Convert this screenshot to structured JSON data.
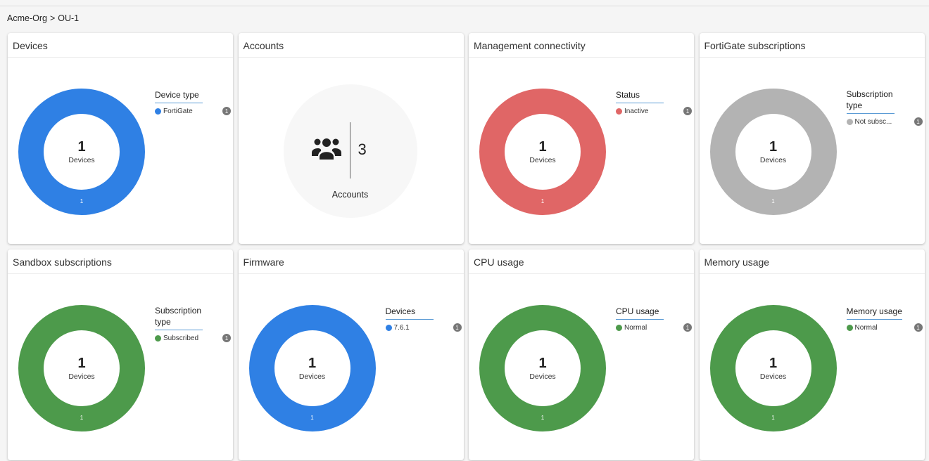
{
  "breadcrumb": {
    "org": "Acme-Org",
    "separator": ">",
    "ou": "OU-1"
  },
  "colors": {
    "blue": "#2f80e4",
    "red": "#e06666",
    "gray": "#b3b3b3",
    "green": "#4d9a4b"
  },
  "cards": {
    "devices": {
      "title": "Devices",
      "donut": {
        "count": "1",
        "label": "Devices",
        "segment_value": "1",
        "color": "#2f80e4"
      },
      "legend": {
        "title": "Device type",
        "items": [
          {
            "label": "FortiGate",
            "count": "1",
            "color": "#2f80e4"
          }
        ]
      }
    },
    "accounts": {
      "title": "Accounts",
      "icon": "users-icon",
      "count": "3",
      "label": "Accounts"
    },
    "management": {
      "title": "Management connectivity",
      "donut": {
        "count": "1",
        "label": "Devices",
        "segment_value": "1",
        "color": "#e06666"
      },
      "legend": {
        "title": "Status",
        "items": [
          {
            "label": "Inactive",
            "count": "1",
            "color": "#e06666"
          }
        ]
      }
    },
    "fortigate_subs": {
      "title": "FortiGate subscriptions",
      "donut": {
        "count": "1",
        "label": "Devices",
        "segment_value": "1",
        "color": "#b3b3b3"
      },
      "legend": {
        "title_line1": "Subscription",
        "title_line2": "type",
        "items": [
          {
            "label": "Not subsc...",
            "count": "1",
            "color": "#b3b3b3"
          }
        ]
      }
    },
    "sandbox_subs": {
      "title": "Sandbox subscriptions",
      "donut": {
        "count": "1",
        "label": "Devices",
        "segment_value": "1",
        "color": "#4d9a4b"
      },
      "legend": {
        "title_line1": "Subscription",
        "title_line2": "type",
        "items": [
          {
            "label": "Subscribed",
            "count": "1",
            "color": "#4d9a4b"
          }
        ]
      }
    },
    "firmware": {
      "title": "Firmware",
      "donut": {
        "count": "1",
        "label": "Devices",
        "segment_value": "1",
        "color": "#2f80e4"
      },
      "legend": {
        "title": "Devices",
        "items": [
          {
            "label": "7.6.1",
            "count": "1",
            "color": "#2f80e4"
          }
        ]
      }
    },
    "cpu": {
      "title": "CPU usage",
      "donut": {
        "count": "1",
        "label": "Devices",
        "segment_value": "1",
        "color": "#4d9a4b"
      },
      "legend": {
        "title": "CPU usage",
        "items": [
          {
            "label": "Normal",
            "count": "1",
            "color": "#4d9a4b"
          }
        ]
      }
    },
    "memory": {
      "title": "Memory usage",
      "donut": {
        "count": "1",
        "label": "Devices",
        "segment_value": "1",
        "color": "#4d9a4b"
      },
      "legend": {
        "title": "Memory usage",
        "items": [
          {
            "label": "Normal",
            "count": "1",
            "color": "#4d9a4b"
          }
        ]
      }
    }
  }
}
